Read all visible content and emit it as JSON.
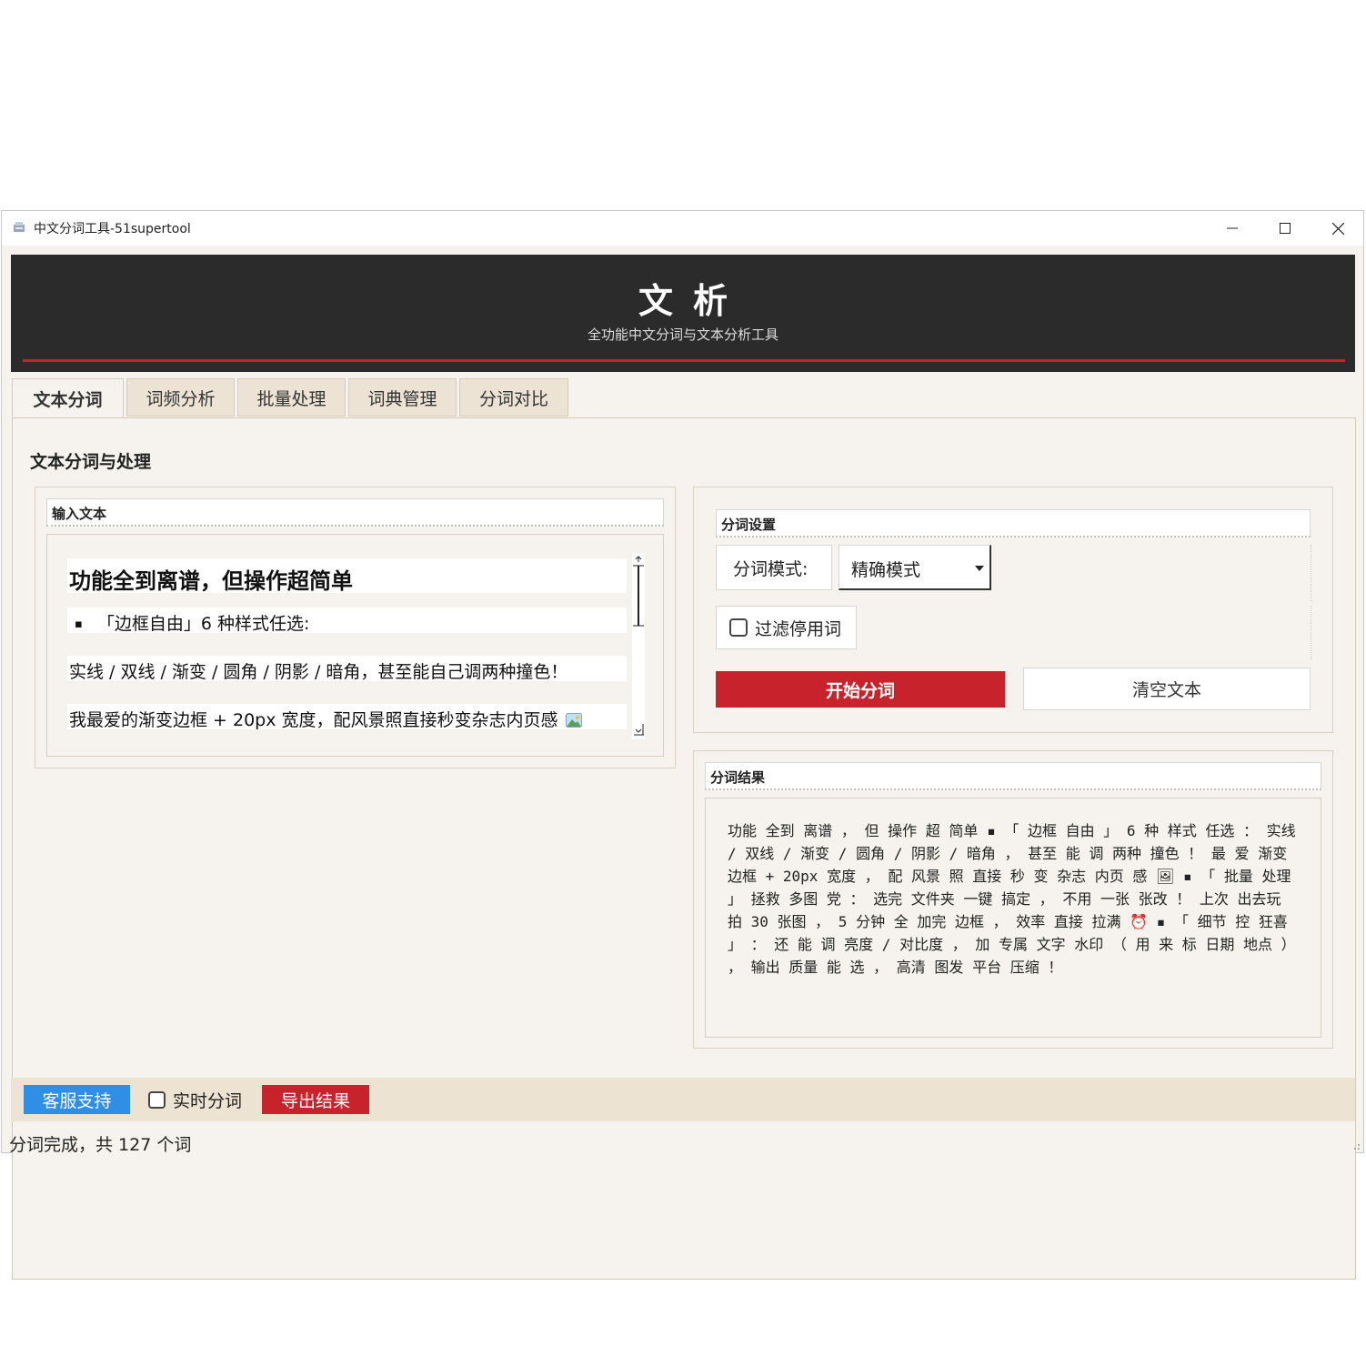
{
  "window": {
    "title": "中文分词工具-51supertool",
    "controls": {
      "minimize": "─",
      "maximize": "☐",
      "close": "✕"
    }
  },
  "header": {
    "title": "文析",
    "subtitle": "全功能中文分词与文本分析工具",
    "accent_color": "#c8232c",
    "bg_color": "#2b2b2b"
  },
  "tabs": [
    {
      "label": "文本分词",
      "active": true
    },
    {
      "label": "词频分析",
      "active": false
    },
    {
      "label": "批量处理",
      "active": false
    },
    {
      "label": "词典管理",
      "active": false
    },
    {
      "label": "分词对比",
      "active": false
    }
  ],
  "main": {
    "section_title": "文本分词与处理",
    "input": {
      "label": "输入文本",
      "heading": "功能全到离谱，但操作超简单",
      "bullet_marker": "▪",
      "bullet": "「边框自由」6 种样式任选:",
      "line1": "实线 / 双线 / 渐变 / 圆角 / 阴影 / 暗角，甚至能自己调两种撞色！",
      "line2": "我最爱的渐变边框 + 20px 宽度，配风景照直接秒变杂志内页感"
    },
    "settings": {
      "label": "分词设置",
      "mode_label": "分词模式:",
      "mode_value": "精确模式",
      "filter_label": "过滤停用词",
      "start_button": "开始分词",
      "clear_button": "清空文本"
    },
    "result": {
      "label": "分词结果",
      "text": "功能 全到 离谱 ， 但 操作 超 简单 ▪ 「 边框 自由 」 6 种 样式 任选 ： 实线 / 双线 / 渐变 / 圆角 / 阴影 / 暗角 ， 甚至 能 调 两种 撞色 ！ 最 爱 渐变 边框 + 20px 宽度 ， 配 风景 照 直接 秒 变 杂志 内页 感 🖼 ▪ 「 批量 处理 」 拯救 多图 党 ： 选完 文件夹 一键 搞定 ， 不用 一张 张改 ！ 上次 出去玩 拍 30 张图 ， 5 分钟 全 加完 边框 ， 效率 直接 拉满 ⏰ ▪ 「 细节 控 狂喜 」 ： 还 能 调 亮度 / 对比度 ， 加 专属 文字 水印 （ 用 来 标 日期 地点 ） ， 输出 质量 能 选 ， 高清 图发 平台 压缩 ！"
    }
  },
  "footer": {
    "support_button": "客服支持",
    "realtime_label": "实时分词",
    "export_button": "导出结果",
    "support_color": "#2f8ee6",
    "export_color": "#c8232c"
  },
  "status": {
    "text": "分词完成，共 127 个词"
  }
}
